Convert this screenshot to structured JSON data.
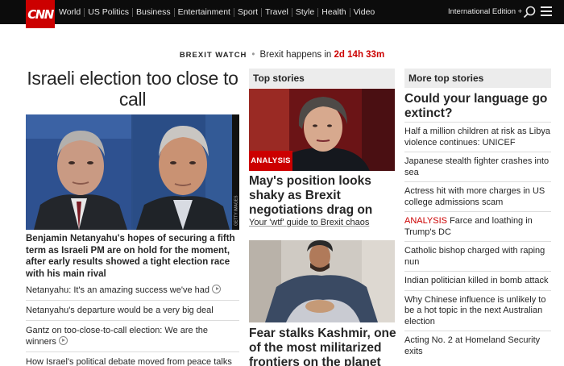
{
  "header": {
    "logo": "CNN",
    "nav": [
      "World",
      "US Politics",
      "Business",
      "Entertainment",
      "Sport",
      "Travel",
      "Style",
      "Health",
      "Video"
    ],
    "edition": "International Edition +"
  },
  "brexit": {
    "tag": "BREXIT WATCH",
    "text": "Brexit happens in",
    "countdown": "2d 14h 33m"
  },
  "left": {
    "headline": "Israeli election too close to call",
    "image_credit": "GETTY IMAGES",
    "lead": "Benjamin Netanyahu's hopes of securing a fifth term as Israeli PM are on hold for the moment, after early results showed a tight election race with his main rival",
    "items": [
      {
        "text": "Netanyahu: It's an amazing success we've had",
        "video": true
      },
      {
        "text": "Netanyahu's departure would be a very big deal",
        "video": false
      },
      {
        "text": "Gantz on too-close-to-call election: We are the winners",
        "video": true
      },
      {
        "text": "How Israel's political debate moved from peace talks",
        "video": false
      }
    ]
  },
  "middle": {
    "section_title": "Top stories",
    "badge": "ANALYSIS",
    "story1_headline": "May's position looks shaky as Brexit negotiations drag on",
    "story1_link": "Your 'wtf' guide to Brexit chaos",
    "story2_headline": "Fear stalks Kashmir, one of the most militarized frontiers on the planet"
  },
  "right": {
    "section_title": "More top stories",
    "big_headline": "Could your language go extinct?",
    "items": [
      {
        "label": "",
        "text": "Half a million children at risk as Libya violence continues: UNICEF"
      },
      {
        "label": "",
        "text": "Japanese stealth fighter crashes into sea"
      },
      {
        "label": "",
        "text": "Actress hit with more charges in US college admissions scam"
      },
      {
        "label": "ANALYSIS",
        "text": "Farce and loathing in Trump's DC"
      },
      {
        "label": "",
        "text": "Catholic bishop charged with raping nun"
      },
      {
        "label": "",
        "text": "Indian politician killed in bomb attack"
      },
      {
        "label": "",
        "text": "Why Chinese influence is unlikely to be a hot topic in the next Australian election"
      },
      {
        "label": "",
        "text": "Acting No. 2 at Homeland Security exits"
      }
    ]
  },
  "colors": {
    "brand": "#cc0000",
    "topbar": "#0c0c0c",
    "section_bg": "#ececec"
  }
}
